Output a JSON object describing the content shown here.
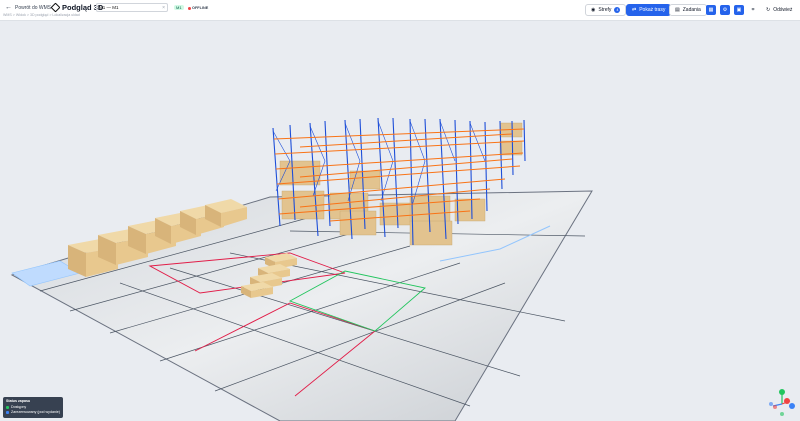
{
  "header": {
    "back_label": "Powrót do WMS",
    "title": "Podgląd 3D",
    "search_value": "M1 — M1",
    "chip": "M1",
    "status": "OFFLINE",
    "breadcrumb": "WMS > Widok > 3D podgląd > Lokalizacja układ"
  },
  "toolbar": {
    "strefy_label": "Strefy",
    "strefy_count": "4",
    "pokaz_label": "Pokaż trasy",
    "zadania_label": "Zadania",
    "odswiez_label": "Odśwież"
  },
  "legend": {
    "title": "Status zapasu",
    "items": [
      {
        "label": "Dostępny",
        "color": "#22c55e"
      },
      {
        "label": "Zarezerwowany (pod wydanie)",
        "color": "#3b82f6"
      }
    ]
  },
  "colors": {
    "accent": "#2563eb",
    "rack_upright": "#1d4ed8",
    "rack_beam": "#f97316",
    "box": "#e2c38f",
    "zone_red": "#e11d48",
    "zone_green": "#22c55e",
    "zone_blue": "#93c5fd"
  }
}
